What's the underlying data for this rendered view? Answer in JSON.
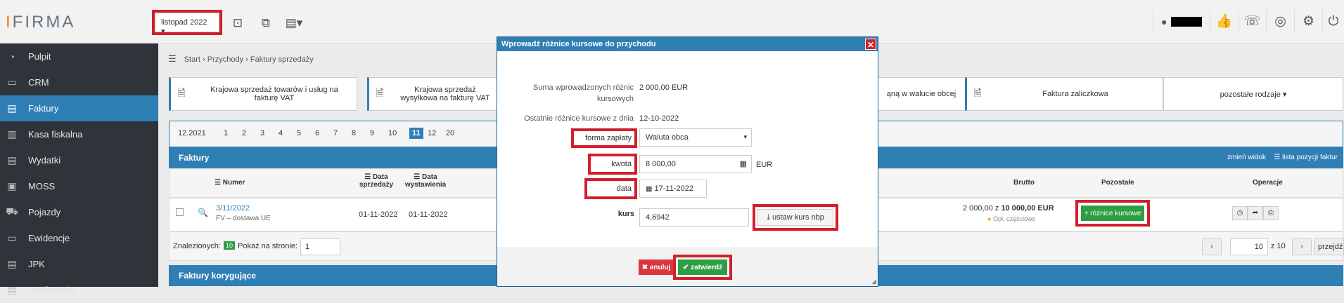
{
  "header": {
    "logo_i": "I",
    "logo_rest": "FIRMA",
    "month_selector": "listopad 2022 ▾",
    "icons": [
      "calculator-icon",
      "copy-icon",
      "clipboard-icon"
    ],
    "right_icons": [
      "thumbs-up-icon",
      "phone-icon",
      "lifebuoy-icon",
      "gear-icon",
      "power-icon"
    ]
  },
  "sidebar": {
    "items": [
      {
        "label": "Pulpit",
        "icon": "◔"
      },
      {
        "label": "CRM",
        "icon": "▭"
      },
      {
        "label": "Faktury",
        "icon": "▤"
      },
      {
        "label": "Kasa fiskalna",
        "icon": "▥"
      },
      {
        "label": "Wydatki",
        "icon": "▤"
      },
      {
        "label": "MOSS",
        "icon": "▣"
      },
      {
        "label": "Pojazdy",
        "icon": "⛟"
      },
      {
        "label": "Ewidencje",
        "icon": "▭"
      },
      {
        "label": "JPK",
        "icon": "▤"
      },
      {
        "label": "Rozliczenia",
        "icon": "▤"
      }
    ]
  },
  "breadcrumb": {
    "menu_icon": "☰",
    "start": "Start",
    "sep": "›",
    "przychody": "Przychody",
    "current": "Faktury sprzedaży"
  },
  "tiles": {
    "t1": "Krajowa sprzedaż towarów i usług na fakturę VAT",
    "t2": "Krajowa sprzedaż wysyłkowa na fakturę VAT",
    "t3": "ąną w walucie obcej",
    "t4": "Faktura zaliczkowa",
    "t5": "pozostałe rodzaje ▾"
  },
  "pager": {
    "first": "12.2021",
    "pages": [
      "1",
      "2",
      "3",
      "4",
      "5",
      "6",
      "7",
      "8",
      "9",
      "10",
      "11",
      "12",
      "20"
    ],
    "active": "11"
  },
  "invoices": {
    "header": "Faktury",
    "change_view": "zmień widok",
    "list_items": "☰ lista pozycji faktur",
    "columns": {
      "numer": "☰ Numer",
      "data_sprzedazy": "☰ Data sprzedaży",
      "data_wystawienia": "☰ Data wystawienia",
      "brutto": "Brutto",
      "pozostale": "Pozostałe",
      "operacje": "Operacje"
    },
    "row": {
      "numer": "3/11/2022",
      "typ": "FV – dostawa UE",
      "data_sprzedazy": "01-11-2022",
      "data_wystawienia": "01-11-2022",
      "brutto_paid": "2 000,00 z",
      "brutto_total": "10 000,00 EUR",
      "status": "Opł. częściowo",
      "roznice_btn": "+ różnice kursowe"
    },
    "footer": {
      "found_label": "Znalezionych:",
      "found_count": "10",
      "per_page_label": "Pokaż na stronie:",
      "per_page_value": "1",
      "page_current": "10",
      "page_total": "z 10",
      "go_button": "przejdź"
    }
  },
  "corrections": {
    "header": "Faktury korygujące"
  },
  "modal": {
    "title": "Wprowadź różnice kursowe do przychodu",
    "close": "✕",
    "sum_label": "Suma wprowadzonych różnic kursowych",
    "sum_value": "2 000,00 EUR",
    "last_label": "Ostatnie różnice kursowe z dnia",
    "last_value": "12-10-2022",
    "forma_label": "forma zapłaty",
    "forma_value": "Waluta obca",
    "kwota_label": "kwota",
    "kwota_value": "8 000,00",
    "kwota_currency": "EUR",
    "data_label": "data",
    "data_value": "17-11-2022",
    "kurs_label": "kurs",
    "kurs_value": "4,6942",
    "nbp_button": "ustaw kurs nbp",
    "cancel_button": "✖ anuluj",
    "confirm_button": "✔ zatwierdź"
  },
  "colors": {
    "accent": "#2f7fb5",
    "highlight": "#d21f2d",
    "success": "#2e9e44",
    "danger": "#d9363e",
    "sidebar": "#2e3439"
  }
}
